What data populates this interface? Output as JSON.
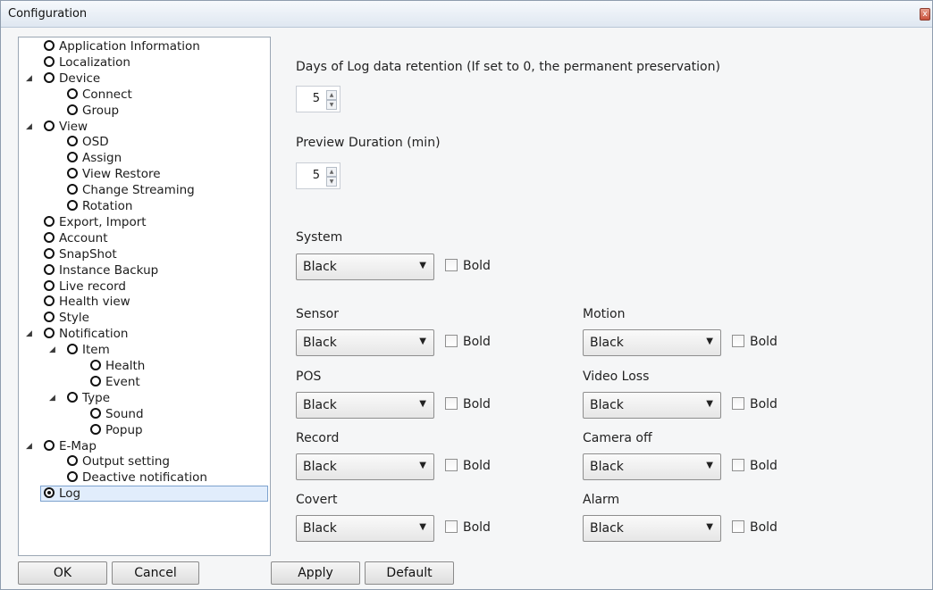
{
  "window": {
    "title": "Configuration",
    "close_glyph": "x"
  },
  "tree": {
    "items": [
      {
        "label": "Application Information",
        "indent": 0,
        "arrow": "",
        "checked": false
      },
      {
        "label": "Localization",
        "indent": 0,
        "arrow": "",
        "checked": false
      },
      {
        "label": "Device",
        "indent": 0,
        "arrow": "◢",
        "checked": false
      },
      {
        "label": "Connect",
        "indent": 1,
        "arrow": "",
        "checked": false
      },
      {
        "label": "Group",
        "indent": 1,
        "arrow": "",
        "checked": false
      },
      {
        "label": "View",
        "indent": 0,
        "arrow": "◢",
        "checked": false
      },
      {
        "label": "OSD",
        "indent": 1,
        "arrow": "",
        "checked": false
      },
      {
        "label": "Assign",
        "indent": 1,
        "arrow": "",
        "checked": false
      },
      {
        "label": "View Restore",
        "indent": 1,
        "arrow": "",
        "checked": false
      },
      {
        "label": "Change Streaming",
        "indent": 1,
        "arrow": "",
        "checked": false
      },
      {
        "label": "Rotation",
        "indent": 1,
        "arrow": "",
        "checked": false
      },
      {
        "label": "Export, Import",
        "indent": 0,
        "arrow": "",
        "checked": false
      },
      {
        "label": "Account",
        "indent": 0,
        "arrow": "",
        "checked": false
      },
      {
        "label": "SnapShot",
        "indent": 0,
        "arrow": "",
        "checked": false
      },
      {
        "label": "Instance Backup",
        "indent": 0,
        "arrow": "",
        "checked": false
      },
      {
        "label": "Live record",
        "indent": 0,
        "arrow": "",
        "checked": false
      },
      {
        "label": "Health view",
        "indent": 0,
        "arrow": "",
        "checked": false
      },
      {
        "label": "Style",
        "indent": 0,
        "arrow": "",
        "checked": false
      },
      {
        "label": "Notification",
        "indent": 0,
        "arrow": "◢",
        "checked": false
      },
      {
        "label": "Item",
        "indent": 1,
        "arrow": "◢",
        "checked": false
      },
      {
        "label": "Health",
        "indent": 2,
        "arrow": "",
        "checked": false
      },
      {
        "label": "Event",
        "indent": 2,
        "arrow": "",
        "checked": false
      },
      {
        "label": "Type",
        "indent": 1,
        "arrow": "◢",
        "checked": false
      },
      {
        "label": "Sound",
        "indent": 2,
        "arrow": "",
        "checked": false
      },
      {
        "label": "Popup",
        "indent": 2,
        "arrow": "",
        "checked": false
      },
      {
        "label": "E-Map",
        "indent": 0,
        "arrow": "◢",
        "checked": false
      },
      {
        "label": "Output setting",
        "indent": 1,
        "arrow": "",
        "checked": false
      },
      {
        "label": "Deactive notification",
        "indent": 1,
        "arrow": "",
        "checked": false
      },
      {
        "label": "Log",
        "indent": 0,
        "arrow": "",
        "checked": true
      }
    ]
  },
  "buttons": {
    "ok": "OK",
    "cancel": "Cancel",
    "apply": "Apply",
    "default": "Default"
  },
  "retention": {
    "label": "Days of Log data retention (If set to 0, the permanent preservation)",
    "value": "5"
  },
  "preview": {
    "label": "Preview Duration (min)",
    "value": "5"
  },
  "color_settings": [
    {
      "label": "System",
      "color": "Black",
      "bold_label": "Bold",
      "bold": false
    },
    {
      "label": "Sensor",
      "color": "Black",
      "bold_label": "Bold",
      "bold": false
    },
    {
      "label": "Motion",
      "color": "Black",
      "bold_label": "Bold",
      "bold": false
    },
    {
      "label": "POS",
      "color": "Black",
      "bold_label": "Bold",
      "bold": false
    },
    {
      "label": "Video Loss",
      "color": "Black",
      "bold_label": "Bold",
      "bold": false
    },
    {
      "label": "Record",
      "color": "Black",
      "bold_label": "Bold",
      "bold": false
    },
    {
      "label": "Camera off",
      "color": "Black",
      "bold_label": "Bold",
      "bold": false
    },
    {
      "label": "Covert",
      "color": "Black",
      "bold_label": "Bold",
      "bold": false
    },
    {
      "label": "Alarm",
      "color": "Black",
      "bold_label": "Bold",
      "bold": false
    }
  ]
}
